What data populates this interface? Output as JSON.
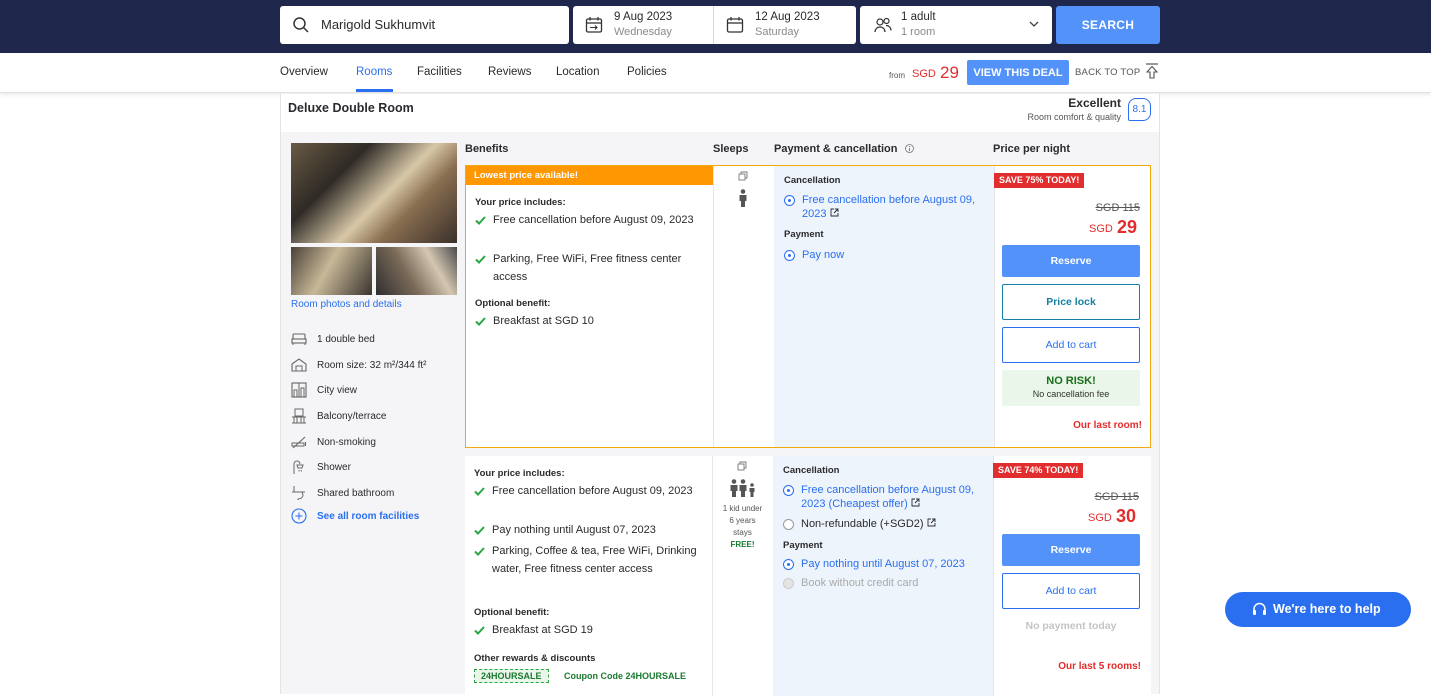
{
  "search": {
    "destination": "Marigold Sukhumvit",
    "button_label": "SEARCH"
  },
  "dates": {
    "checkin_date": "9 Aug 2023",
    "checkin_day": "Wednesday",
    "checkout_date": "12 Aug 2023",
    "checkout_day": "Saturday"
  },
  "guests": {
    "adults": "1 adult",
    "rooms": "1 room"
  },
  "nav": {
    "tabs": [
      "Overview",
      "Rooms",
      "Facilities",
      "Reviews",
      "Location",
      "Policies"
    ],
    "active_tab": "Rooms",
    "from_label": "from",
    "from_currency": "SGD",
    "from_price": "29",
    "deal_button": "VIEW THIS DEAL",
    "back_to_top": "BACK TO TOP"
  },
  "room": {
    "title": "Deluxe Double Room",
    "rating_word": "Excellent",
    "rating_sub": "Room comfort & quality",
    "rating_score": "8.1",
    "photos_link": "Room photos and details",
    "amenities": [
      {
        "icon": "bed-icon",
        "label": "1 double bed"
      },
      {
        "icon": "room-size-icon",
        "label": "Room size: 32 m²/344 ft²"
      },
      {
        "icon": "city-view-icon",
        "label": "City view"
      },
      {
        "icon": "balcony-icon",
        "label": "Balcony/terrace"
      },
      {
        "icon": "non-smoking-icon",
        "label": "Non-smoking"
      },
      {
        "icon": "shower-icon",
        "label": "Shower"
      },
      {
        "icon": "shared-bathroom-icon",
        "label": "Shared bathroom"
      }
    ],
    "see_all": "See all room facilities"
  },
  "columns": {
    "benefits": "Benefits",
    "sleeps": "Sleeps",
    "payment": "Payment & cancellation",
    "price": "Price per night"
  },
  "offers": [
    {
      "ribbon": "Lowest price available!",
      "price_includes_label": "Your price includes:",
      "includes": [
        "Free cancellation before August 09, 2023",
        "Parking, Free WiFi, Free fitness center access"
      ],
      "optional_label": "Optional benefit:",
      "optional": [
        "Breakfast at SGD 10"
      ],
      "cancellation_label": "Cancellation",
      "cancellation": [
        "Free cancellation before August 09, 2023"
      ],
      "payment_label": "Payment",
      "payment": [
        "Pay now"
      ],
      "save_tag": "SAVE 75% TODAY!",
      "old_price": "SGD 115",
      "currency": "SGD",
      "price": "29",
      "reserve": "Reserve",
      "price_lock": "Price lock",
      "add_to_cart": "Add to cart",
      "no_risk_title": "NO RISK!",
      "no_risk_sub": "No cancellation fee",
      "availability": "Our last room!"
    },
    {
      "price_includes_label": "Your price includes:",
      "includes": [
        "Free cancellation before August 09, 2023",
        "Pay nothing until August 07, 2023",
        "Parking, Coffee & tea, Free WiFi, Drinking water, Free fitness center access"
      ],
      "optional_label": "Optional benefit:",
      "optional": [
        "Breakfast at SGD 19"
      ],
      "rewards_label": "Other rewards & discounts",
      "coupon_code": "24HOURSALE",
      "coupon_text": "Coupon Code 24HOURSALE",
      "kid_line1": "1 kid under",
      "kid_line2": "6 years",
      "kid_line3": "stays",
      "kid_free": "FREE!",
      "cancellation_label": "Cancellation",
      "cancellation": [
        "Free cancellation before August 09, 2023 (Cheapest offer)",
        "Non-refundable (+SGD2)"
      ],
      "payment_label": "Payment",
      "payment": [
        "Pay nothing until August 07, 2023",
        "Book without credit card"
      ],
      "save_tag": "SAVE 74% TODAY!",
      "old_price": "SGD 115",
      "currency": "SGD",
      "price": "30",
      "reserve": "Reserve",
      "add_to_cart": "Add to cart",
      "no_payment": "No payment today",
      "availability": "Our last 5 rooms!"
    }
  ],
  "help": {
    "label": "We're here to help"
  },
  "colors": {
    "navy": "#20274d",
    "accent": "#5392f9",
    "link": "#2a6ff0",
    "sale": "#e12d2d",
    "ribbon": "#fe9700",
    "green": "#28a745"
  }
}
